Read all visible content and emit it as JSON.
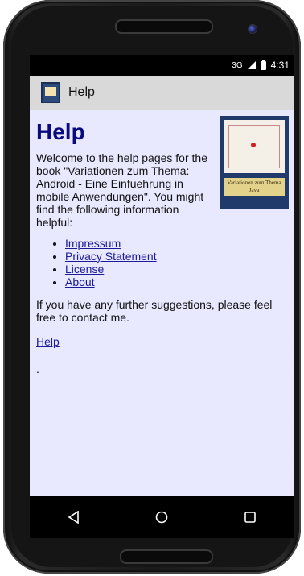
{
  "status": {
    "signal": "3G",
    "time": "4:31"
  },
  "appbar": {
    "title": "Help"
  },
  "page": {
    "heading": "Help",
    "intro": "Welcome to the help pages for the book \"Variationen zum Thema: Android - Eine Einfuehrung in mobile Anwendungen\".  You might find the following information helpful:",
    "links": [
      "Impressum",
      "Privacy Statement",
      "License",
      "About"
    ],
    "contact": "If you have any further suggestions, please feel free to contact me.",
    "help_link": "Help",
    "trailing": "."
  },
  "book": {
    "cover_text": "Variationen zum Thema Java"
  },
  "colors": {
    "accent": "#0a0a80",
    "link": "#1a1a9a",
    "background": "#e8e8ff"
  }
}
